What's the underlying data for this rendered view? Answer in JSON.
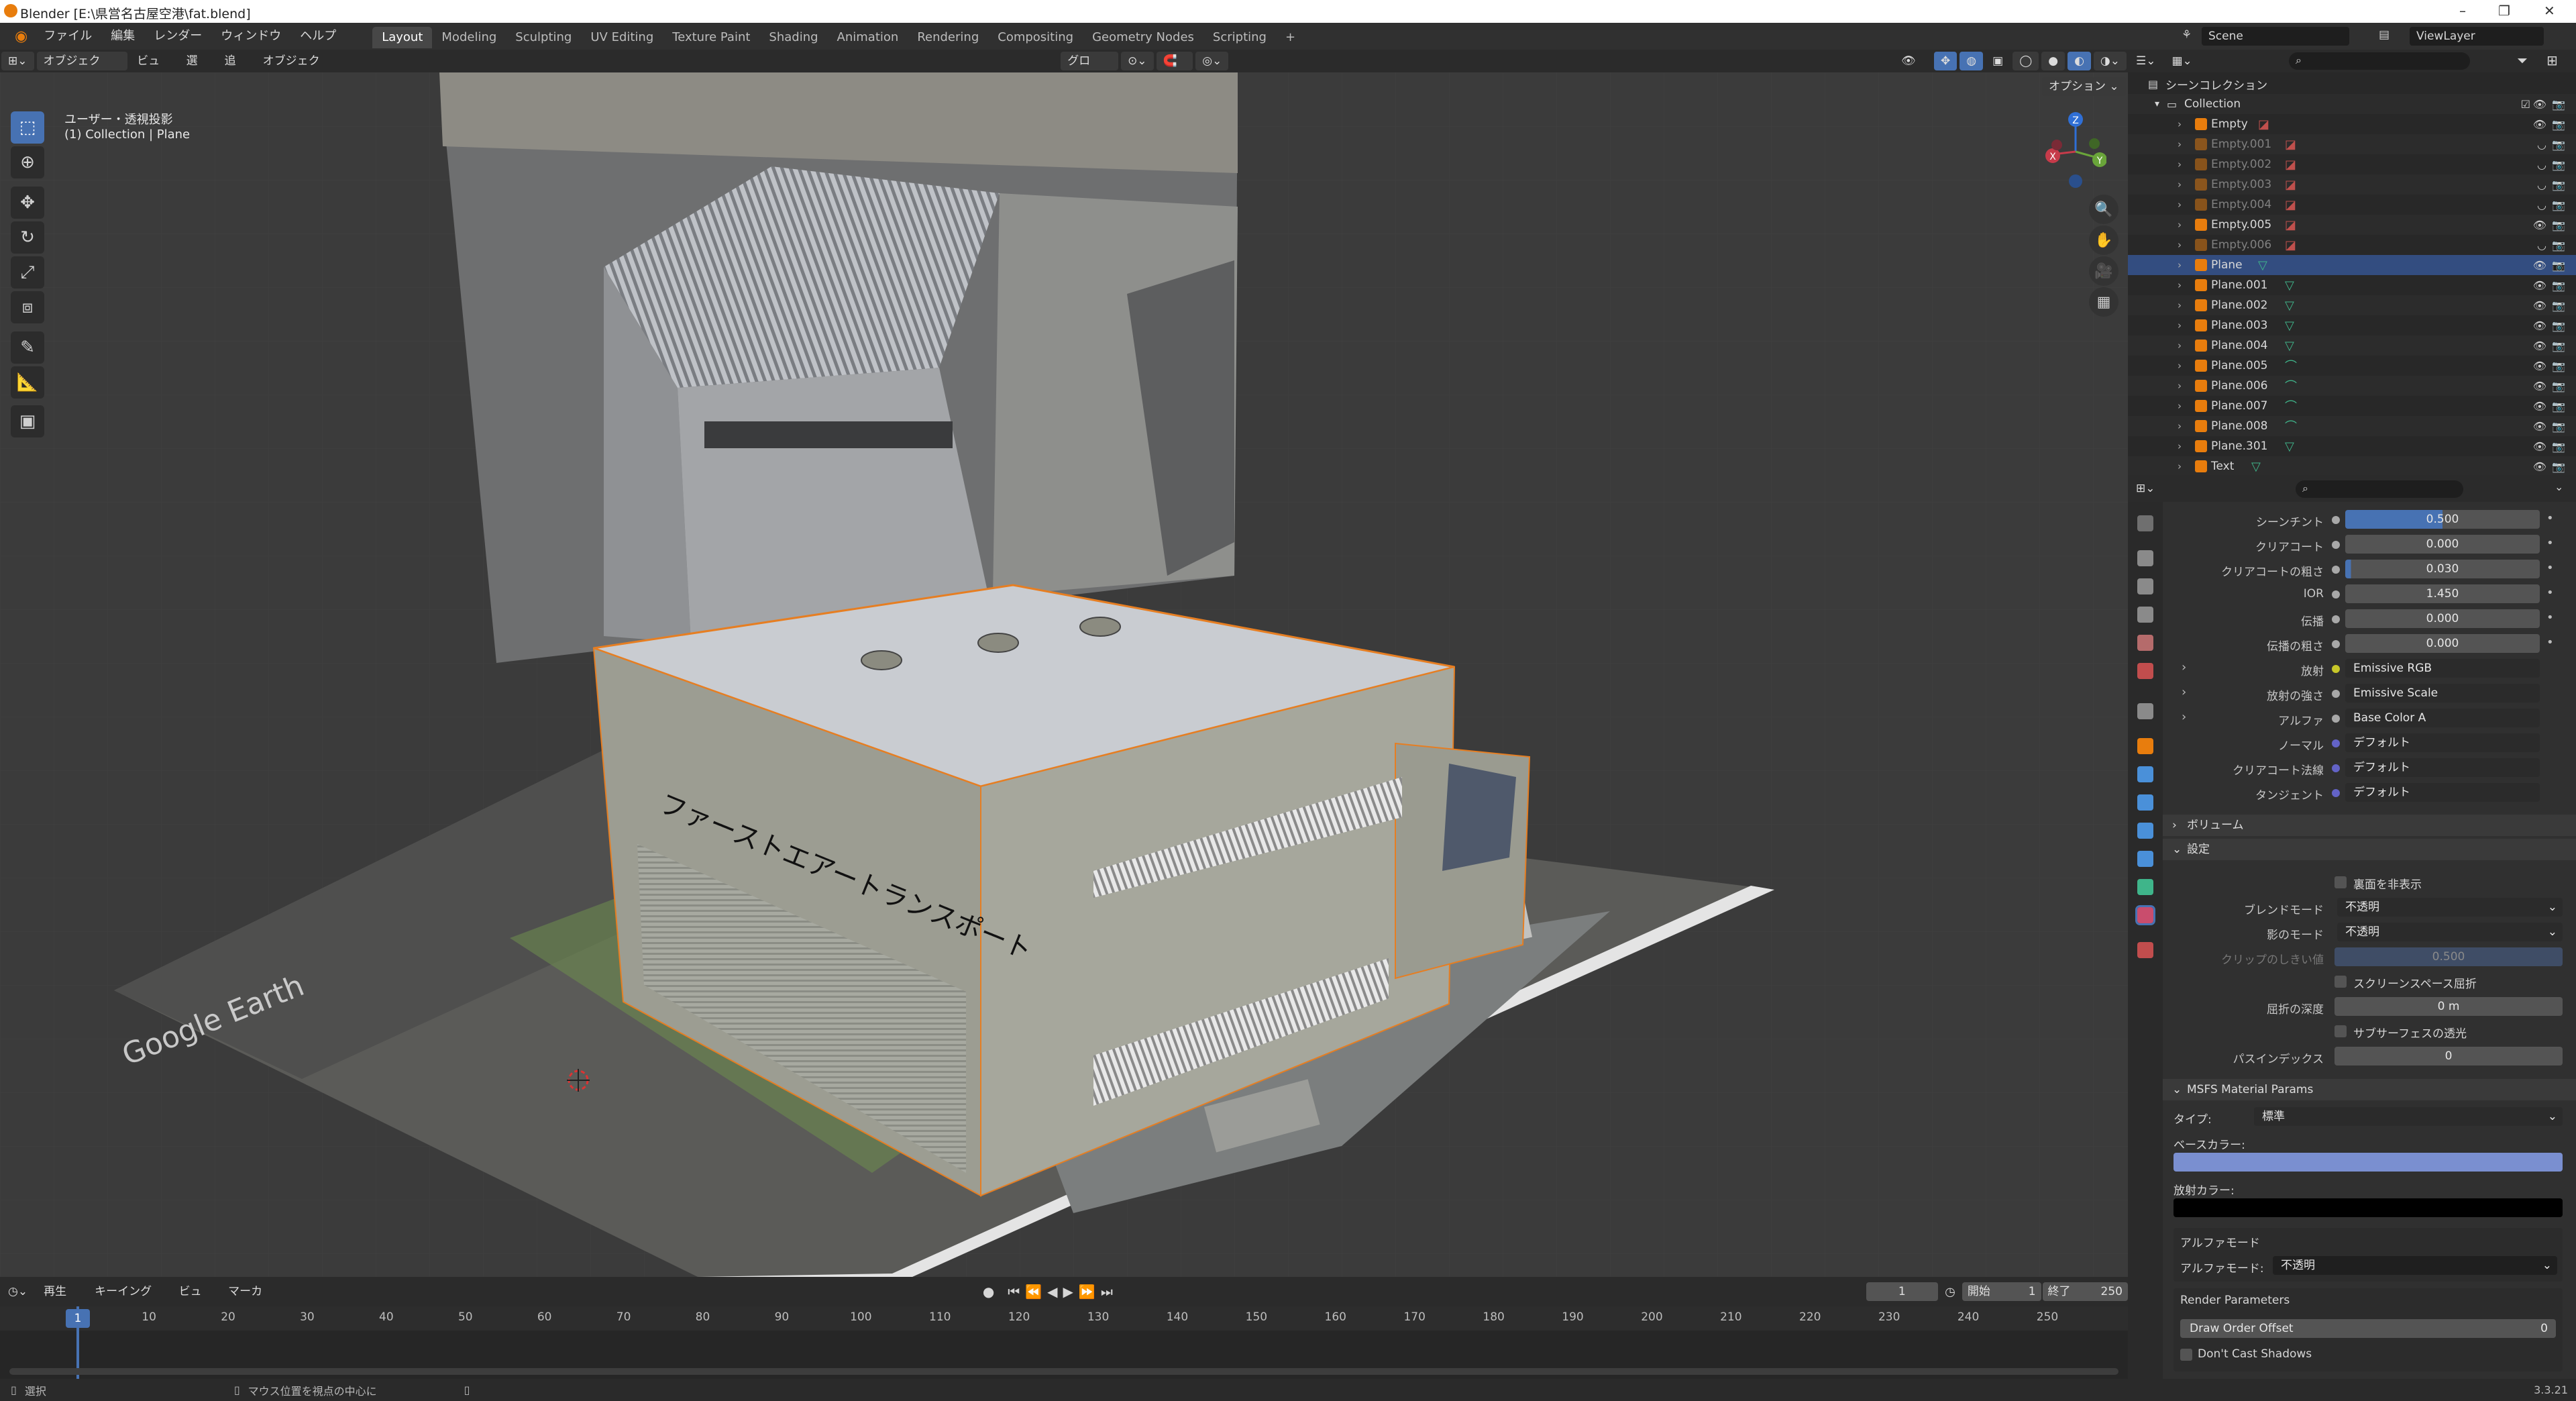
{
  "window": {
    "title": "Blender [E:\\県営名古屋空港\\fat.blend]",
    "minimize": "–",
    "maximize": "❐",
    "close": "✕"
  },
  "menu": [
    "ファイル",
    "編集",
    "レンダー",
    "ウィンドウ",
    "ヘルプ"
  ],
  "workspaces": [
    "Layout",
    "Modeling",
    "Sculpting",
    "UV Editing",
    "Texture Paint",
    "Shading",
    "Animation",
    "Rendering",
    "Compositing",
    "Geometry Nodes",
    "Scripting",
    "+"
  ],
  "scene": {
    "name": "Scene",
    "view_layer": "ViewLayer"
  },
  "viewport_header": {
    "mode": "オブジェクト...",
    "menus": [
      "ビュー",
      "選択",
      "追加",
      "オブジェクト"
    ],
    "transform": "グロー...",
    "options": "オプション ⌄"
  },
  "viewport": {
    "view_name": "ユーザー・透視投影",
    "collection_info": "(1) Collection | Plane",
    "building_text": "ファーストエアートランスポート",
    "ground_watermark": "Google Earth"
  },
  "gizmo": {
    "x": "X",
    "y": "Y",
    "z": "Z"
  },
  "timeline": {
    "menus": [
      "再生 ⌄",
      "キーイング ⌄",
      "ビュー",
      "マーカー"
    ],
    "current_frame": "1",
    "start_label": "開始",
    "start": "1",
    "end_label": "終了",
    "end": "250",
    "ticks": [
      "1",
      "10",
      "20",
      "30",
      "40",
      "50",
      "60",
      "70",
      "80",
      "90",
      "100",
      "110",
      "120",
      "130",
      "140",
      "150",
      "160",
      "170",
      "180",
      "190",
      "200",
      "210",
      "220",
      "230",
      "240",
      "250"
    ]
  },
  "statusbar": {
    "left": "選択",
    "middle": "マウス位置を視点の中心に",
    "version": "3.3.21"
  },
  "outliner": {
    "scene_collection": "シーンコレクション",
    "collection": "Collection",
    "items": [
      {
        "name": "Empty",
        "type": "empty",
        "dim": false,
        "selected": false
      },
      {
        "name": "Empty.001",
        "type": "empty",
        "dim": true,
        "selected": false
      },
      {
        "name": "Empty.002",
        "type": "empty",
        "dim": true,
        "selected": false
      },
      {
        "name": "Empty.003",
        "type": "empty",
        "dim": true,
        "selected": false
      },
      {
        "name": "Empty.004",
        "type": "empty",
        "dim": true,
        "selected": false
      },
      {
        "name": "Empty.005",
        "type": "empty",
        "dim": false,
        "selected": false
      },
      {
        "name": "Empty.006",
        "type": "empty",
        "dim": true,
        "selected": false
      },
      {
        "name": "Plane",
        "type": "mesh",
        "dim": false,
        "selected": true
      },
      {
        "name": "Plane.001",
        "type": "mesh",
        "dim": false,
        "selected": false
      },
      {
        "name": "Plane.002",
        "type": "mesh",
        "dim": false,
        "selected": false
      },
      {
        "name": "Plane.003",
        "type": "mesh",
        "dim": false,
        "selected": false
      },
      {
        "name": "Plane.004",
        "type": "mesh",
        "dim": false,
        "selected": false
      },
      {
        "name": "Plane.005",
        "type": "curve",
        "dim": false,
        "selected": false
      },
      {
        "name": "Plane.006",
        "type": "curve",
        "dim": false,
        "selected": false
      },
      {
        "name": "Plane.007",
        "type": "curve",
        "dim": false,
        "selected": false
      },
      {
        "name": "Plane.008",
        "type": "curve",
        "dim": false,
        "selected": false
      },
      {
        "name": "Plane.301",
        "type": "mesh",
        "dim": false,
        "selected": false
      },
      {
        "name": "Text",
        "type": "mesh",
        "dim": false,
        "selected": false
      }
    ]
  },
  "properties": {
    "value_rows": [
      {
        "label": "シーンチント",
        "value": "0.500",
        "dot": "#a8a8a8",
        "fill": 0.5
      },
      {
        "label": "クリアコート",
        "value": "0.000",
        "dot": "#a8a8a8",
        "fill": 0
      },
      {
        "label": "クリアコートの粗さ",
        "value": "0.030",
        "dot": "#a8a8a8",
        "fill": 0.03
      },
      {
        "label": "IOR",
        "value": "1.450",
        "dot": "#a8a8a8",
        "fill": 0
      },
      {
        "label": "伝播",
        "value": "0.000",
        "dot": "#a8a8a8",
        "fill": 0
      },
      {
        "label": "伝播の粗さ",
        "value": "0.000",
        "dot": "#a8a8a8",
        "fill": 0
      }
    ],
    "link_rows": [
      {
        "label": "放射",
        "value": "Emissive RGB",
        "dot": "#c7c729"
      },
      {
        "label": "放射の強さ",
        "value": "Emissive Scale",
        "dot": "#a8a8a8"
      },
      {
        "label": "アルファ",
        "value": "Base Color A",
        "dot": "#a8a8a8"
      },
      {
        "label": "ノーマル",
        "value": "デフォルト",
        "dot": "#6363c7"
      },
      {
        "label": "クリアコート法線",
        "value": "デフォルト",
        "dot": "#6363c7"
      },
      {
        "label": "タンジェント",
        "value": "デフォルト",
        "dot": "#6363c7"
      }
    ],
    "volume_section": "ボリューム",
    "settings_section": "設定",
    "backface_label": "裏面を非表示",
    "blend_mode_label": "ブレンドモード",
    "blend_mode_value": "不透明",
    "shadow_mode_label": "影のモード",
    "shadow_mode_value": "不透明",
    "clip_label": "クリップのしきい値",
    "clip_value": "0.500",
    "ssr_label": "スクリーンスペース屈折",
    "refraction_depth_label": "屈折の深度",
    "refraction_depth_value": "0 m",
    "subsurface_label": "サブサーフェスの透光",
    "pass_index_label": "パスインデックス",
    "pass_index_value": "0",
    "msfs_section": "MSFS Material Params",
    "type_label": "タイプ:",
    "type_value": "標準",
    "base_color_label": "ベースカラー:",
    "base_color": "#7a8fd0",
    "emissive_label": "放射カラー:",
    "emissive_color": "#000000",
    "alpha_mode_header": "アルファモード",
    "alpha_mode_label": "アルファモード:",
    "alpha_mode_value": "不透明",
    "render_params": "Render Parameters",
    "draw_order_label": "Draw Order Offset",
    "draw_order_value": "0",
    "no_shadows_label": "Don't Cast Shadows"
  },
  "colors": {
    "accent": "#4772b3",
    "selected_row": "#334d80",
    "orange": "#e87d0d"
  }
}
